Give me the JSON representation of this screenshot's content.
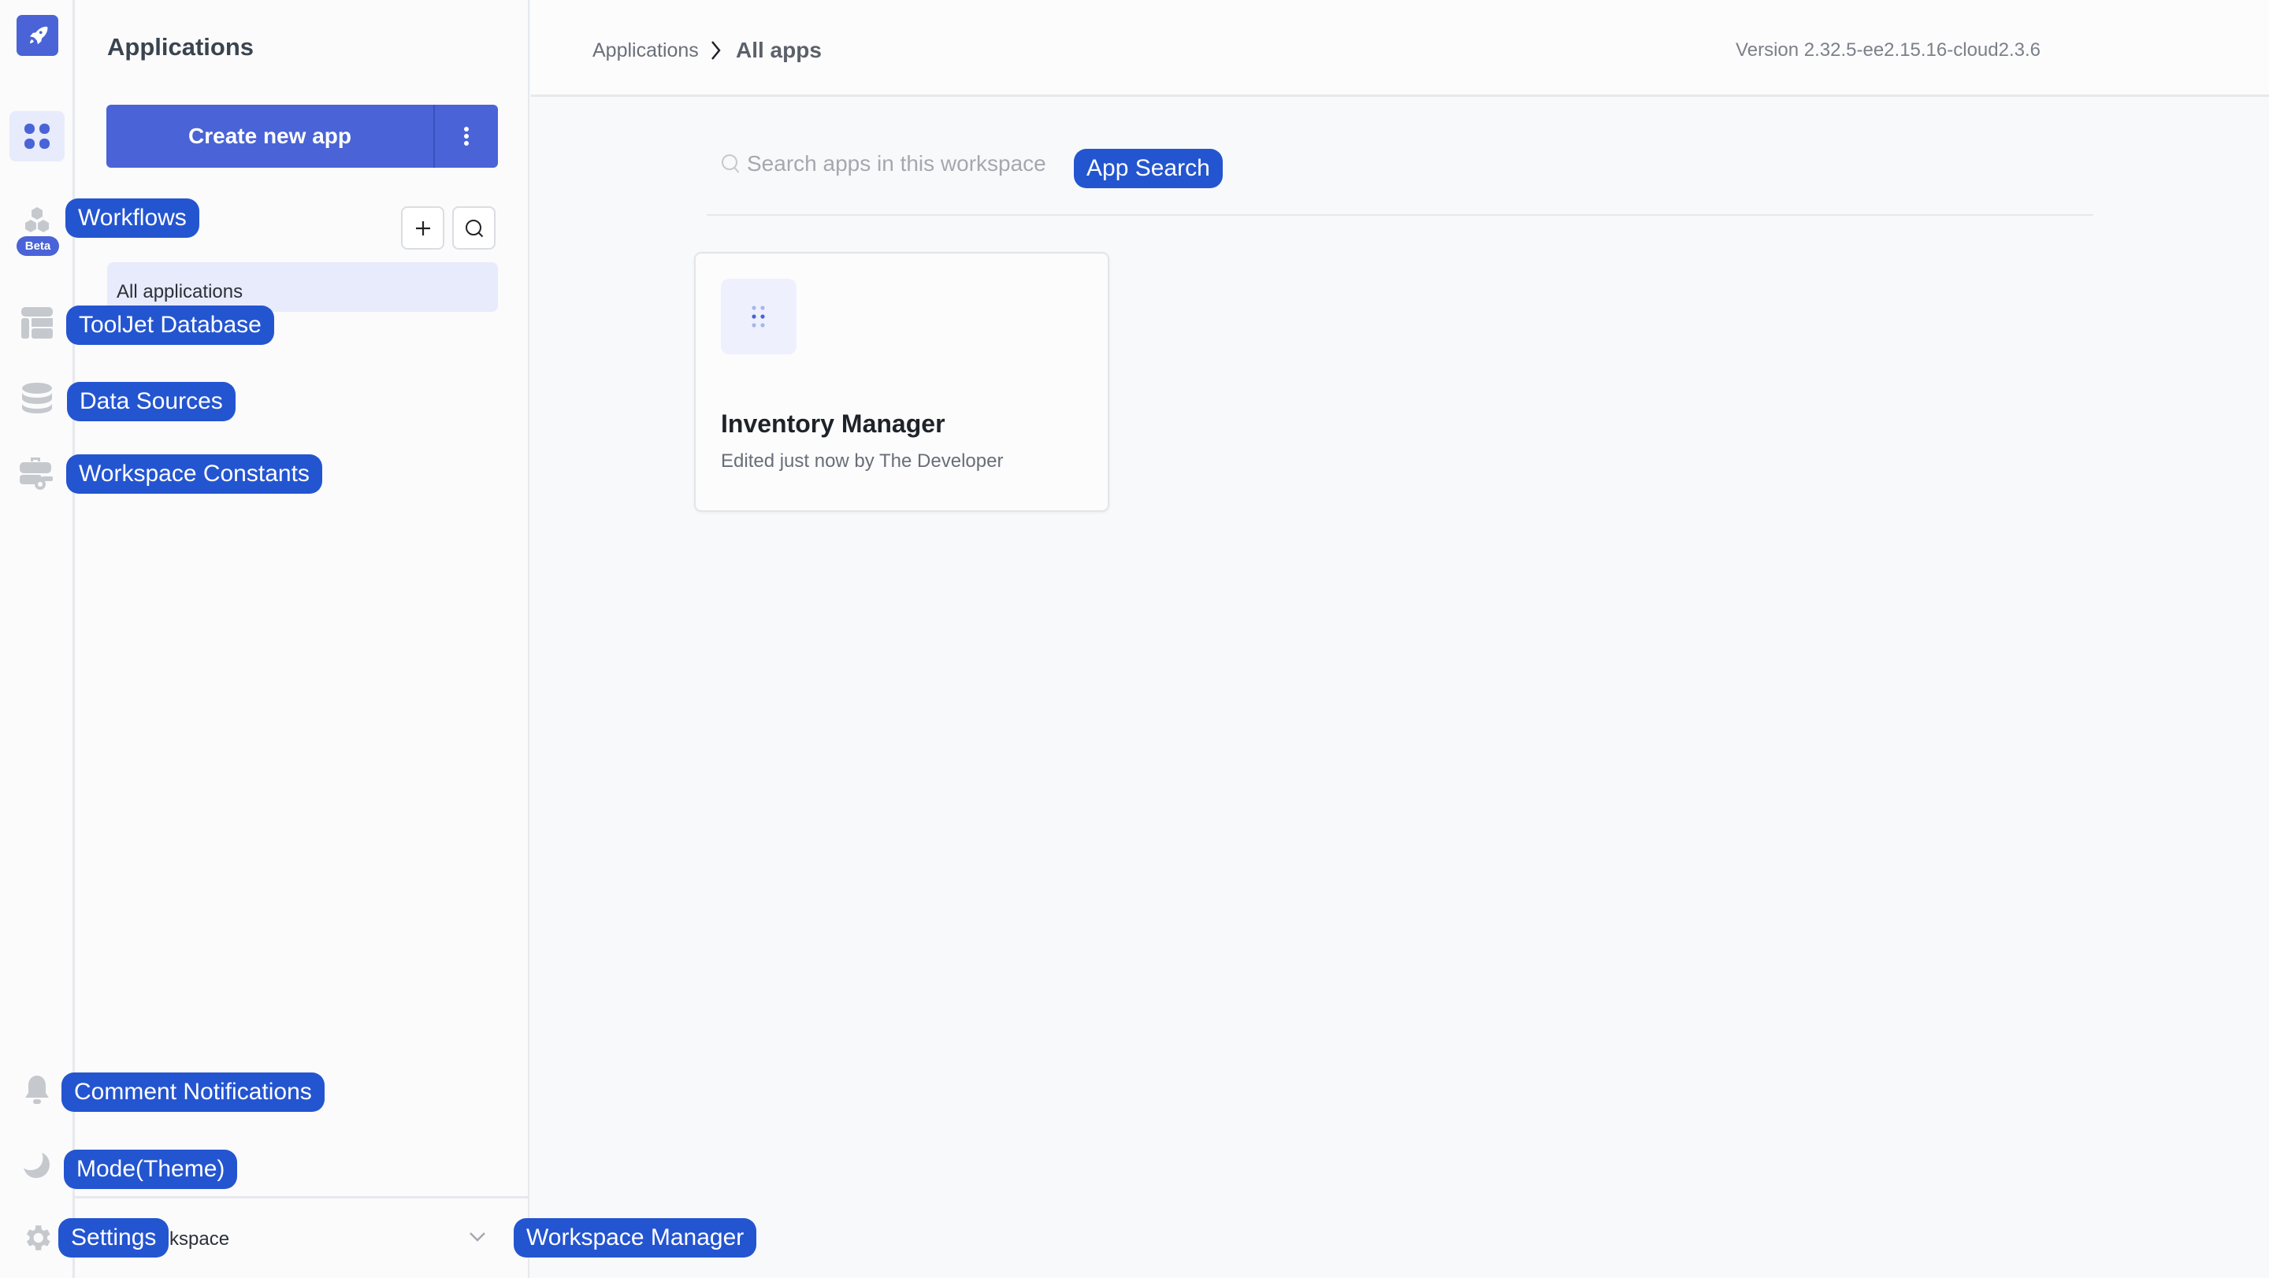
{
  "rail": {
    "beta_badge": "Beta",
    "items": [
      {
        "name": "apps",
        "icon": "apps-grid-icon",
        "active": true
      },
      {
        "name": "workflows",
        "icon": "hexagons-icon",
        "active": false
      },
      {
        "name": "database",
        "icon": "table-icon",
        "active": false
      },
      {
        "name": "data-sources",
        "icon": "database-icon",
        "active": false
      },
      {
        "name": "workspace-constants",
        "icon": "briefcase-key-icon",
        "active": false
      },
      {
        "name": "notifications",
        "icon": "bell-icon",
        "active": false
      },
      {
        "name": "theme",
        "icon": "moon-icon",
        "active": false
      },
      {
        "name": "settings",
        "icon": "gear-icon",
        "active": false
      }
    ]
  },
  "panel": {
    "title": "Applications",
    "create_label": "Create new app",
    "folders": [
      "All applications"
    ],
    "workspace_text": "kspace"
  },
  "header": {
    "breadcrumb": [
      "Applications",
      "All apps"
    ],
    "version": "Version 2.32.5-ee2.15.16-cloud2.3.6"
  },
  "search": {
    "placeholder": "Search apps in this workspace",
    "value": ""
  },
  "apps": [
    {
      "name": "Inventory Manager",
      "subtitle": "Edited just now by The Developer"
    }
  ],
  "labels": {
    "workflows": "Workflows",
    "database": "ToolJet Database",
    "data_sources": "Data Sources",
    "workspace_constants": "Workspace Constants",
    "comment_notifications": "Comment Notifications",
    "theme": "Mode(Theme)",
    "settings": "Settings",
    "workspace_manager": "Workspace Manager",
    "app_search": "App Search"
  },
  "colors": {
    "brand": "#4a63d6",
    "label": "#2455d0"
  }
}
